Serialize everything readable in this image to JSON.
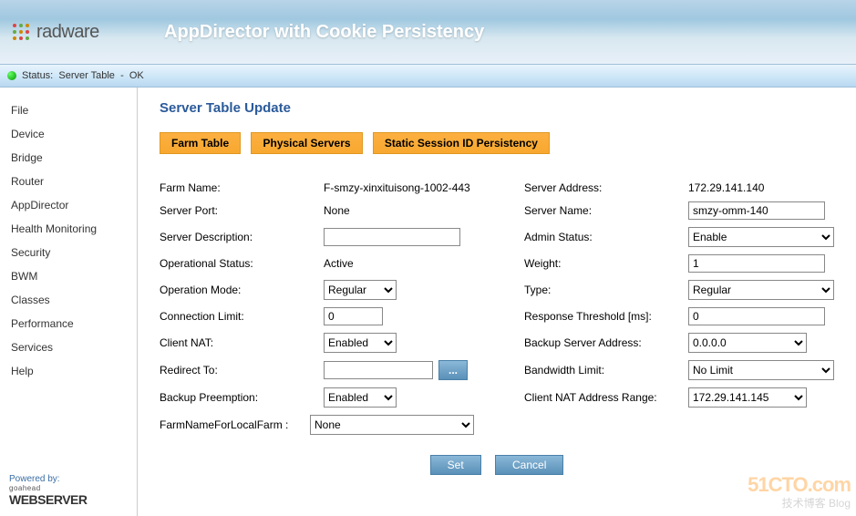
{
  "brand": "radware",
  "header_title": "AppDirector with Cookie Persistency",
  "status": {
    "label": "Status:",
    "context": "Server Table",
    "sep": "-",
    "value": "OK"
  },
  "sidebar": {
    "items": [
      "File",
      "Device",
      "Bridge",
      "Router",
      "AppDirector",
      "Health Monitoring",
      "Security",
      "BWM",
      "Classes",
      "Performance",
      "Services",
      "Help"
    ],
    "powered_by": "Powered by:",
    "goahead": "goahead",
    "webserver": "WEBSERVER"
  },
  "page_title": "Server Table Update",
  "tabs": [
    "Farm Table",
    "Physical Servers",
    "Static Session ID Persistency"
  ],
  "form": {
    "farm_name_label": "Farm Name:",
    "farm_name_value": "F-smzy-xinxituisong-1002-443",
    "server_address_label": "Server Address:",
    "server_address_value": "172.29.141.140",
    "server_port_label": "Server Port:",
    "server_port_value": "None",
    "server_name_label": "Server Name:",
    "server_name_value": "smzy-omm-140",
    "server_description_label": "Server Description:",
    "server_description_value": "",
    "admin_status_label": "Admin Status:",
    "admin_status_value": "Enable",
    "operational_status_label": "Operational Status:",
    "operational_status_value": "Active",
    "weight_label": "Weight:",
    "weight_value": "1",
    "operation_mode_label": "Operation Mode:",
    "operation_mode_value": "Regular",
    "type_label": "Type:",
    "type_value": "Regular",
    "connection_limit_label": "Connection Limit:",
    "connection_limit_value": "0",
    "response_threshold_label": "Response Threshold [ms]:",
    "response_threshold_value": "0",
    "client_nat_label": "Client NAT:",
    "client_nat_value": "Enabled",
    "backup_server_address_label": "Backup Server Address:",
    "backup_server_address_value": "0.0.0.0",
    "redirect_to_label": "Redirect To:",
    "redirect_to_value": "",
    "redirect_browse": "...",
    "bandwidth_limit_label": "Bandwidth Limit:",
    "bandwidth_limit_value": "No Limit",
    "backup_preemption_label": "Backup Preemption:",
    "backup_preemption_value": "Enabled",
    "client_nat_range_label": "Client NAT Address Range:",
    "client_nat_range_value": "172.29.141.145",
    "farm_local_label": "FarmNameForLocalFarm :",
    "farm_local_value": "None"
  },
  "buttons": {
    "set": "Set",
    "cancel": "Cancel"
  },
  "watermark": {
    "line1": "51CTO.com",
    "line2": "技术博客    Blog"
  }
}
